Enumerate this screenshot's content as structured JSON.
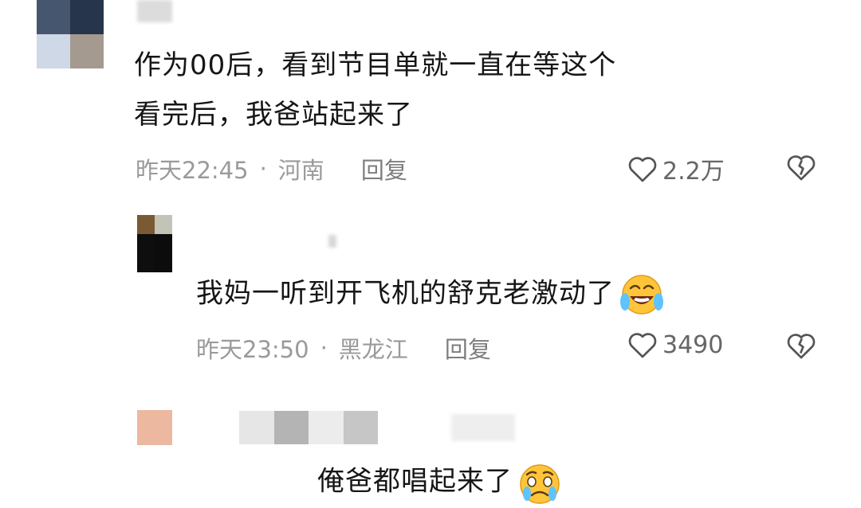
{
  "comments": [
    {
      "text_line1": "作为00后，看到节目单就一直在等这个",
      "text_line2": "看完后，我爸站起来了",
      "time": "昨天22:45",
      "location": "河南",
      "reply_label": "回复",
      "likes": "2.2万"
    },
    {
      "text": "我妈一听到开飞机的舒克老激动了",
      "emoji": "laughing-crying-emoji",
      "time": "昨天23:50",
      "location": "黑龙江",
      "reply_label": "回复",
      "likes": "3490"
    },
    {
      "text": "俺爸都唱起来了",
      "emoji": "crying-emoji"
    }
  ],
  "separator": "·",
  "colors": {
    "text": "#161616",
    "meta": "#9a9a9a",
    "icon": "#555555"
  },
  "icons": [
    "heart-icon",
    "broken-heart-icon"
  ]
}
